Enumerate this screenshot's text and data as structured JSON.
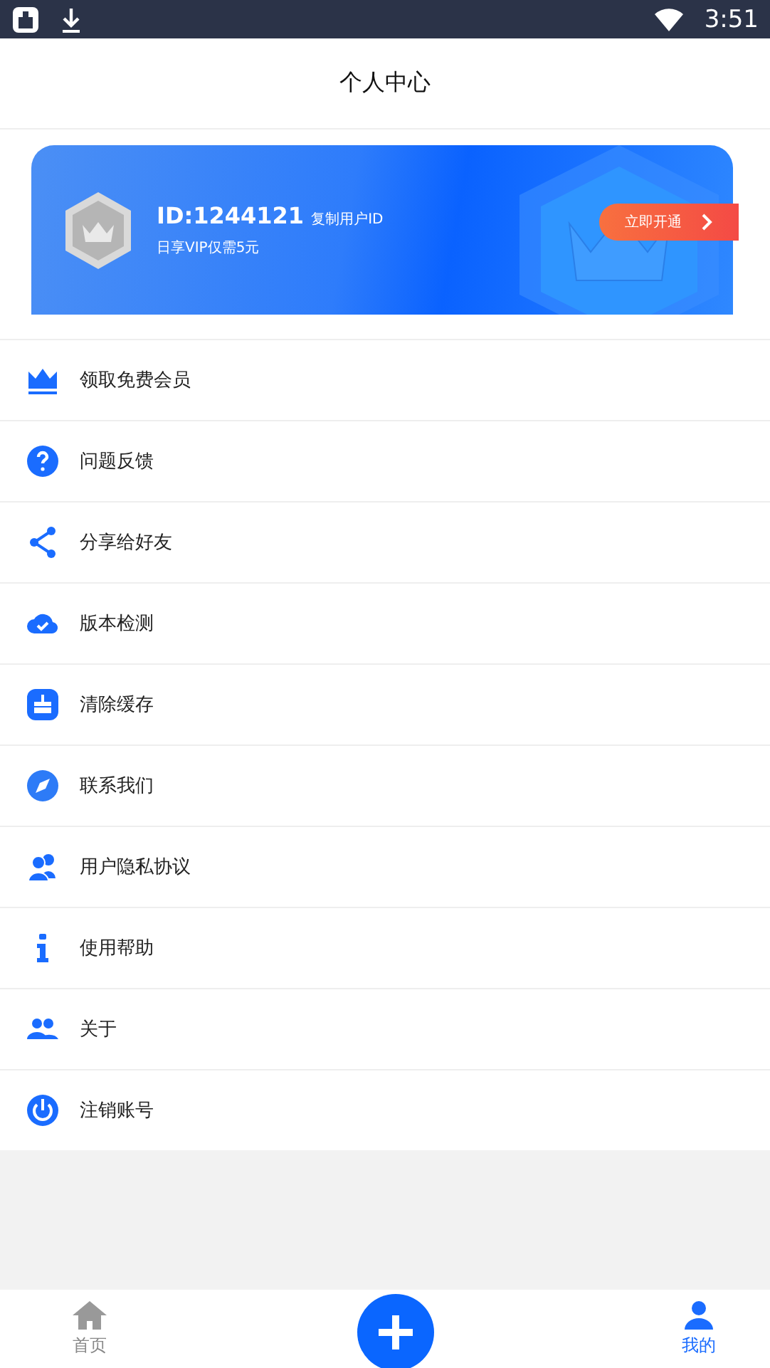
{
  "status_bar": {
    "time": "3:51"
  },
  "header": {
    "title": "个人中心"
  },
  "vip_card": {
    "user_id": "ID:1244121",
    "copy_link": "复制用户ID",
    "promo": "日享VIP仅需5元",
    "button": "立即开通"
  },
  "menu": [
    {
      "kind": "crown",
      "label": "领取免费会员"
    },
    {
      "kind": "question",
      "label": "问题反馈"
    },
    {
      "kind": "share",
      "label": "分享给好友"
    },
    {
      "kind": "cloud",
      "label": "版本检测"
    },
    {
      "kind": "broom",
      "label": "清除缓存"
    },
    {
      "kind": "compass",
      "label": "联系我们"
    },
    {
      "kind": "users",
      "label": "用户隐私协议"
    },
    {
      "kind": "info",
      "label": "使用帮助"
    },
    {
      "kind": "group",
      "label": "关于"
    },
    {
      "kind": "power",
      "label": "注销账号"
    }
  ],
  "tab_bar": [
    {
      "kind": "home",
      "label": "首页",
      "selected": false
    },
    {
      "kind": "add"
    },
    {
      "kind": "mine",
      "label": "我的",
      "selected": true
    }
  ]
}
